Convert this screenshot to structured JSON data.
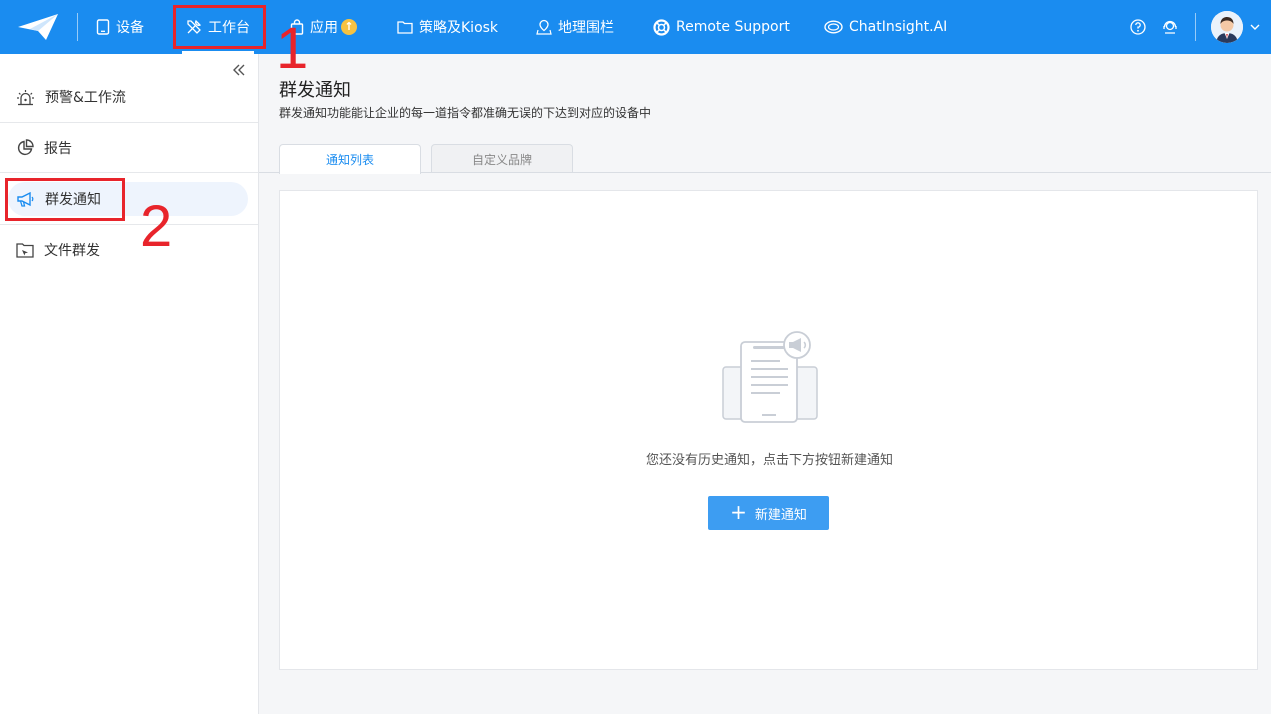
{
  "topbar": {
    "nav": [
      {
        "label": "设备",
        "icon": "tablet-icon"
      },
      {
        "label": "工作台",
        "icon": "tools-icon",
        "active": true
      },
      {
        "label": "应用",
        "icon": "shopping-bag-icon",
        "badge": "↑"
      },
      {
        "label": "策略及Kiosk",
        "icon": "folder-icon"
      },
      {
        "label": "地理围栏",
        "icon": "map-pin-icon"
      },
      {
        "label": "Remote Support",
        "icon": "lifebuoy-icon"
      },
      {
        "label": "ChatInsight.AI",
        "icon": "chat-icon"
      }
    ],
    "help_icon": "help-circle-icon",
    "support_icon": "headset-icon",
    "accent": "#1a8cf0"
  },
  "annotations": {
    "one": "1",
    "two": "2",
    "color": "#e8242b"
  },
  "sidebar": {
    "items": [
      {
        "label": "预警&工作流",
        "icon": "alarm-icon"
      },
      {
        "label": "报告",
        "icon": "pie-chart-icon"
      },
      {
        "label": "群发通知",
        "icon": "megaphone-icon",
        "selected": true
      },
      {
        "label": "文件群发",
        "icon": "folder-send-icon"
      }
    ]
  },
  "main": {
    "title": "群发通知",
    "description": "群发通知功能能让企业的每一道指令都准确无误的下达到对应的设备中",
    "tabs": [
      {
        "label": "通知列表",
        "active": true
      },
      {
        "label": "自定义品牌",
        "active": false
      }
    ],
    "empty_text": "您还没有历史通知，点击下方按钮新建通知",
    "new_button": "新建通知"
  }
}
